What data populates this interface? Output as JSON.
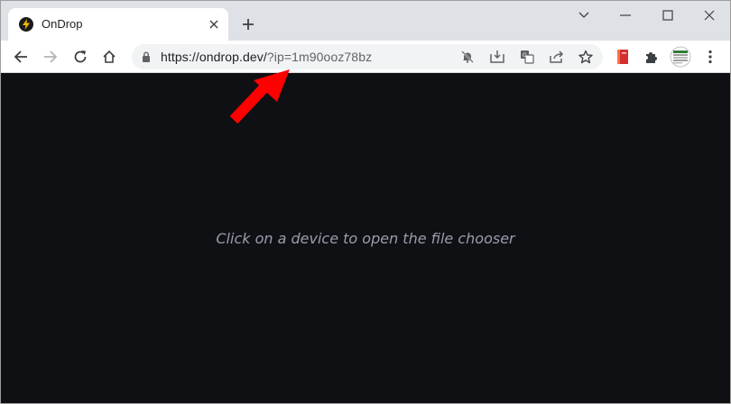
{
  "tab": {
    "title": "OnDrop",
    "favicon": "lightning-bolt-icon"
  },
  "toolbar": {
    "url_main": "https://ondrop.dev/",
    "url_rest": "?ip=1m90ooz78bz"
  },
  "content": {
    "hint": "Click on a device to open the file chooser"
  },
  "colors": {
    "tabstrip": "#dee1e6",
    "toolbar": "#ffffff",
    "omnibox": "#f1f3f4",
    "page_background": "#0f1014",
    "hint_text": "#9a9cab",
    "annotation_arrow": "#ff0000",
    "favicon_bolt": "#f5b800"
  }
}
